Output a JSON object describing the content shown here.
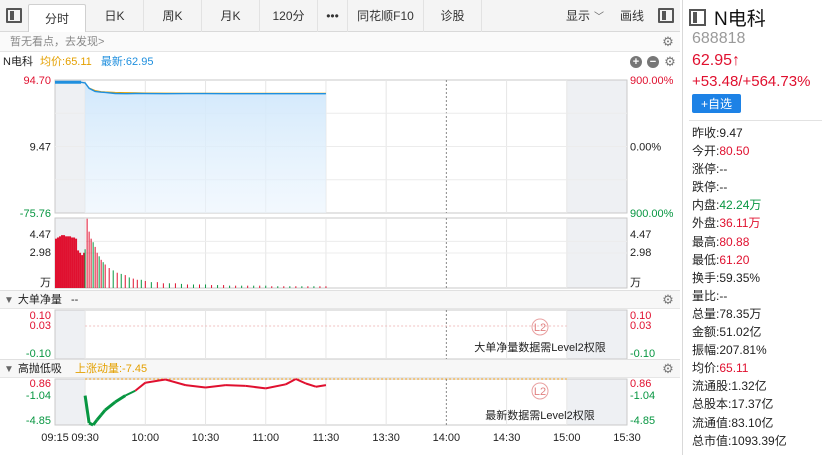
{
  "toolbar": {
    "tabs": [
      "分时",
      "日K",
      "周K",
      "月K",
      "120分",
      "•••",
      "同花顺F10",
      "诊股"
    ],
    "display_label": "显示",
    "draw_label": "画线"
  },
  "notice": {
    "text": "暂无看点，去发现>"
  },
  "chart_header": {
    "name": "N电科",
    "avg_label": "均价:65.11",
    "last_label": "最新:62.95"
  },
  "sub_panels": {
    "panel1": {
      "title": "大单净量",
      "extra": "--",
      "msg": "大单净量数据需Level2权限"
    },
    "panel2": {
      "title": "高抛低吸",
      "extra": "上涨动量:-7.45",
      "msg": "最新数据需Level2权限"
    }
  },
  "colors": {
    "up": "#e0102f",
    "down": "#079641",
    "price_line": "#1f8fde",
    "avg_line": "#e4a000",
    "accent": "#1d82e6"
  },
  "chart_data": {
    "type": "line",
    "title": "",
    "time_labels": [
      "09:15",
      "09:30",
      "10:00",
      "10:30",
      "11:00",
      "11:30",
      "13:30",
      "14:00",
      "14:30",
      "15:00",
      "15:30"
    ],
    "time_minutes": [
      -15,
      0,
      30,
      60,
      90,
      120,
      150,
      180,
      210,
      240,
      270
    ],
    "price_axis": {
      "left_ticks": [
        "94.70",
        "9.47",
        "-75.76"
      ],
      "right_ticks": [
        "900.00%",
        "0.00%",
        "900.00%"
      ],
      "ylim": [
        -75.76,
        94.7
      ]
    },
    "volume_axis": {
      "left_ticks": [
        "4.47",
        "2.98",
        "万"
      ],
      "right_ticks": [
        "4.47",
        "2.98",
        "万"
      ],
      "max": 5.96
    },
    "sub1_axis": {
      "ticks": [
        "0.10",
        "0.03",
        "-0.10"
      ]
    },
    "sub2_axis": {
      "ticks": [
        "0.86",
        "-1.04",
        "-4.85"
      ]
    },
    "series": [
      {
        "name": "最新",
        "minutes": [
          -15,
          -10,
          -5,
          -2,
          0,
          2,
          5,
          8,
          10,
          15,
          20,
          25,
          30,
          40,
          50,
          60,
          70,
          80,
          90,
          100,
          110,
          120
        ],
        "values": [
          91.8,
          91.8,
          91.8,
          91.8,
          91.0,
          84.0,
          80.0,
          79.0,
          78.8,
          77.4,
          77.2,
          77.4,
          77.3,
          77.2,
          77.3,
          77.3,
          77.2,
          77.2,
          77.2,
          77.2,
          77.1,
          77.1
        ]
      },
      {
        "name": "均价",
        "minutes": [
          0,
          2,
          5,
          8,
          10,
          15,
          20,
          25,
          30,
          40,
          50,
          60,
          70,
          80,
          90,
          100,
          110,
          120
        ],
        "values": [
          91.0,
          84.5,
          81.2,
          79.8,
          79.4,
          78.8,
          78.5,
          78.3,
          78.1,
          77.9,
          77.8,
          77.8,
          77.7,
          77.7,
          77.7,
          77.6,
          77.6,
          77.6
        ]
      }
    ],
    "volume": {
      "minutes": [
        -15,
        -14,
        -13,
        -12,
        -11,
        -10,
        -9,
        -8,
        -7,
        -6,
        -5,
        -4,
        -3,
        -2,
        -1,
        0,
        1,
        2,
        3,
        4,
        5,
        6,
        7,
        8,
        9,
        10,
        12,
        14,
        16,
        18,
        20,
        22,
        24,
        26,
        28,
        30,
        33,
        36,
        39,
        42,
        45,
        48,
        51,
        54,
        57,
        60,
        63,
        66,
        69,
        72,
        75,
        78,
        81,
        84,
        87,
        90,
        93,
        96,
        99,
        102,
        105,
        108,
        111,
        114,
        117,
        120
      ],
      "values": [
        4.2,
        4.3,
        4.4,
        4.5,
        4.5,
        4.4,
        4.4,
        4.4,
        4.3,
        4.3,
        4.2,
        3.2,
        3.0,
        2.8,
        3.0,
        3.3,
        5.9,
        4.8,
        4.2,
        3.9,
        3.5,
        3.0,
        2.7,
        2.4,
        2.2,
        2.0,
        1.7,
        1.5,
        1.3,
        1.2,
        1.1,
        0.9,
        0.8,
        0.7,
        0.7,
        0.6,
        0.5,
        0.5,
        0.4,
        0.4,
        0.4,
        0.35,
        0.3,
        0.3,
        0.3,
        0.3,
        0.25,
        0.25,
        0.25,
        0.2,
        0.2,
        0.2,
        0.2,
        0.2,
        0.2,
        0.2,
        0.15,
        0.15,
        0.15,
        0.15,
        0.15,
        0.15,
        0.15,
        0.15,
        0.15,
        0.15
      ]
    },
    "volume_up": [
      true,
      true,
      true,
      true,
      true,
      true,
      true,
      true,
      true,
      true,
      true,
      true,
      true,
      true,
      true,
      false,
      true,
      true,
      true,
      false,
      true,
      true,
      false,
      true,
      false,
      true,
      true,
      false,
      true,
      false,
      true,
      false,
      true,
      true,
      false,
      true,
      false,
      true,
      true,
      false,
      true,
      false,
      true,
      false,
      true,
      false,
      true,
      false,
      true,
      false,
      true,
      false,
      true,
      false,
      true,
      false,
      true,
      false,
      true,
      false,
      true,
      false,
      true,
      false,
      true,
      true
    ],
    "momentum": {
      "minutes": [
        0,
        2,
        4,
        6,
        8,
        10,
        15,
        20,
        25,
        30,
        40,
        50,
        60,
        70,
        80,
        90,
        100,
        105,
        110,
        115,
        120
      ],
      "values": [
        -1.2,
        -4.6,
        -4.85,
        -4.2,
        -3.6,
        -3.0,
        -2.0,
        -1.2,
        -0.6,
        0.4,
        0.8,
        0.1,
        -0.2,
        0.1,
        0.0,
        -0.3,
        0.2,
        0.86,
        0.3,
        -0.1,
        0.1
      ]
    }
  },
  "quote": {
    "name": "N电科",
    "code": "688818",
    "price": "62.95↑",
    "change": "+53.48/+564.73%",
    "add_label": "+自选",
    "rows": [
      {
        "k": "昨收:",
        "v": "9.47",
        "c": "dark"
      },
      {
        "k": "今开:",
        "v": "80.50",
        "c": "red"
      },
      {
        "k": "涨停:",
        "v": "--",
        "c": "dark"
      },
      {
        "k": "跌停:",
        "v": "--",
        "c": "dark"
      },
      {
        "k": "内盘:",
        "v": "42.24万",
        "c": "green"
      },
      {
        "k": "外盘:",
        "v": "36.11万",
        "c": "red"
      },
      {
        "k": "最高:",
        "v": "80.88",
        "c": "red"
      },
      {
        "k": "最低:",
        "v": "61.20",
        "c": "red"
      },
      {
        "k": "换手:",
        "v": "59.35%",
        "c": "dark"
      },
      {
        "k": "量比:",
        "v": "--",
        "c": "dark"
      },
      {
        "k": "总量:",
        "v": "78.35万",
        "c": "dark"
      },
      {
        "k": "金额:",
        "v": "51.02亿",
        "c": "dark"
      },
      {
        "k": "振幅:",
        "v": "207.81%",
        "c": "dark"
      },
      {
        "k": "均价:",
        "v": "65.11",
        "c": "red"
      },
      {
        "k": "流通股:",
        "v": "1.32亿",
        "c": "dark"
      },
      {
        "k": "总股本:",
        "v": "17.37亿",
        "c": "dark"
      },
      {
        "k": "流通值:",
        "v": "83.10亿",
        "c": "dark"
      },
      {
        "k": "总市值:",
        "v": "1093.39亿",
        "c": "dark"
      }
    ]
  }
}
